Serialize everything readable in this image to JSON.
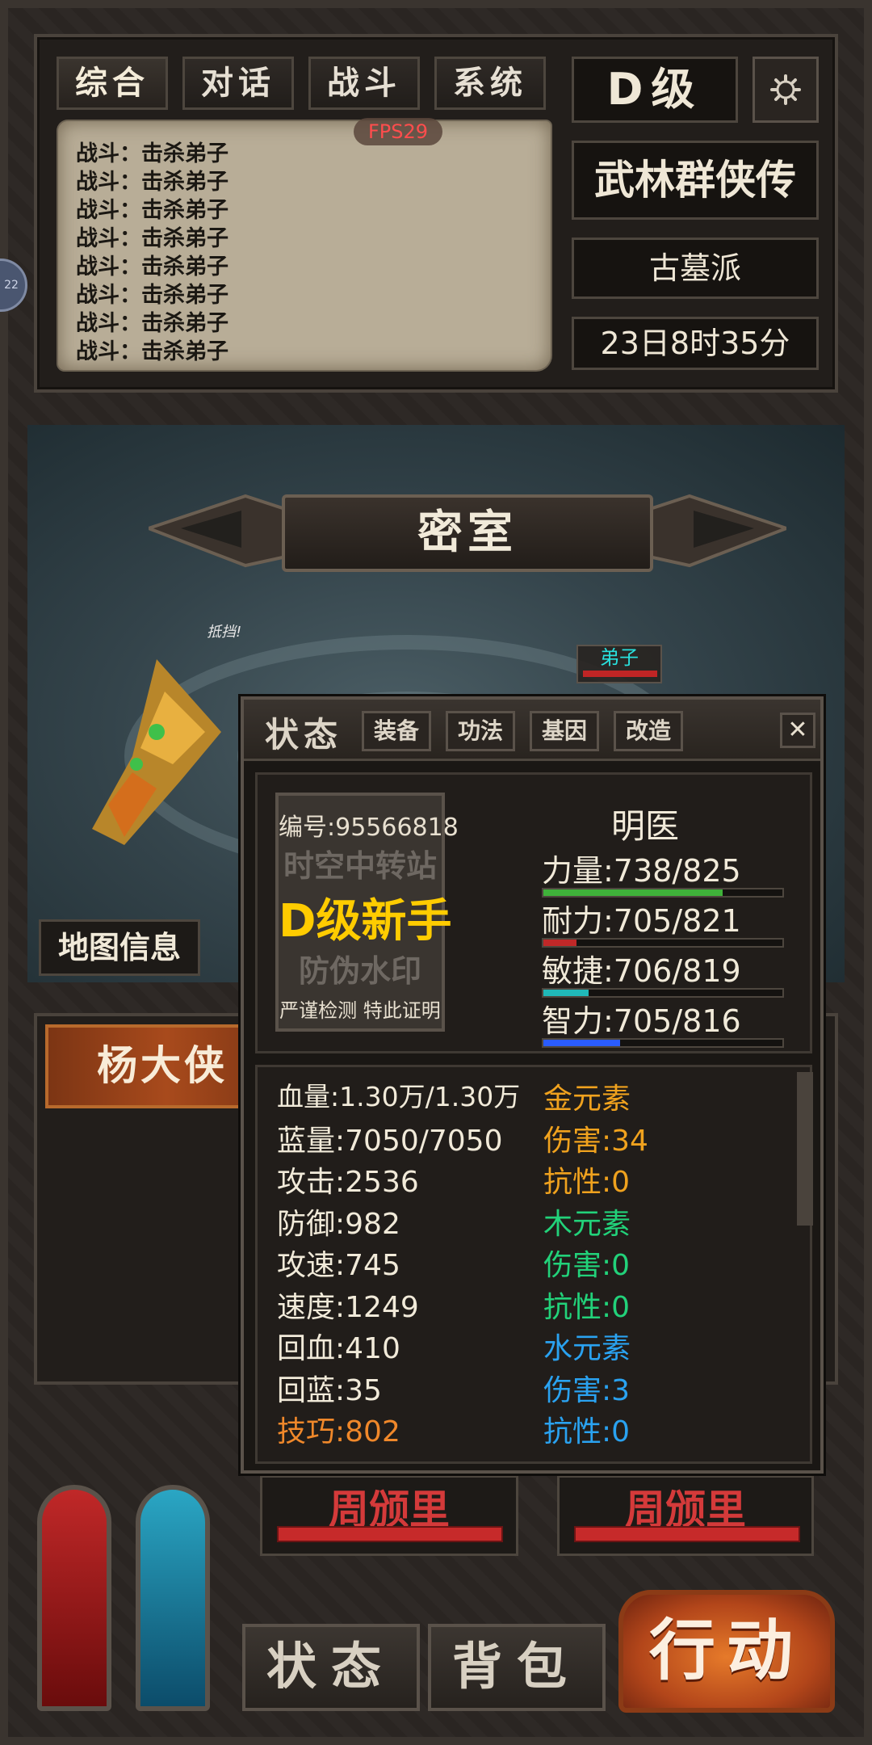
{
  "tabs": [
    "综合",
    "对话",
    "战斗",
    "系统"
  ],
  "fps": "FPS29",
  "log": [
    "战斗：击杀弟子",
    "战斗：击杀弟子",
    "战斗：击杀弟子",
    "战斗：击杀弟子",
    "战斗：击杀弟子",
    "战斗：击杀弟子",
    "战斗：击杀弟子",
    "战斗：击杀弟子"
  ],
  "grade": "D级",
  "game_title": "武林群侠传",
  "sect": "古墓派",
  "game_time": "23日8时35分",
  "side_badge": "22",
  "map": {
    "title": "密室",
    "info_button": "地图信息",
    "block_text": "抵挡!",
    "enemy_name": "弟子"
  },
  "hero_tab": "杨大侠",
  "hp_labels": [
    "周颁里",
    "周颁里"
  ],
  "bottom_buttons": {
    "status": "状态",
    "bag": "背包",
    "action": "行动"
  },
  "dialog": {
    "title": "状态",
    "tabs": [
      "装备",
      "功法",
      "基因",
      "改造"
    ],
    "close": "✕",
    "watermark": [
      "编号:95566818",
      "时空中转站",
      "D级新手",
      "防伪水印",
      "严谨检测 特此证明"
    ],
    "name": "明医",
    "attributes": [
      {
        "label": "力量:738/825",
        "value": 738,
        "max": 825,
        "color": "#3fb23a"
      },
      {
        "label": "耐力:705/821",
        "value": 705,
        "max": 821,
        "color": "#c02828"
      },
      {
        "label": "敏捷:706/819",
        "value": 706,
        "max": 819,
        "color": "#20b8b8"
      },
      {
        "label": "智力:705/816",
        "value": 705,
        "max": 816,
        "color": "#2a5cff"
      }
    ],
    "attribute_bar_fill": [
      0.75,
      0.14,
      0.19,
      0.32
    ],
    "left_stats": [
      "血量:1.30万/1.30万",
      "蓝量:7050/7050",
      "攻击:2536",
      "防御:982",
      "攻速:745",
      "速度:1249",
      "回血:410",
      "回蓝:35",
      "技巧:802"
    ],
    "right_stats": [
      {
        "text": "金元素",
        "color": "#f0a21e"
      },
      {
        "text": "伤害:34",
        "color": "#f0a21e"
      },
      {
        "text": "抗性:0",
        "color": "#f0a21e"
      },
      {
        "text": "木元素",
        "color": "#22d27a"
      },
      {
        "text": "伤害:0",
        "color": "#22d27a"
      },
      {
        "text": "抗性:0",
        "color": "#22d27a"
      },
      {
        "text": "水元素",
        "color": "#2aa2f0"
      },
      {
        "text": "伤害:3",
        "color": "#2aa2f0"
      },
      {
        "text": "抗性:0",
        "color": "#2aa2f0"
      }
    ],
    "skill_color": "#f0882a"
  }
}
